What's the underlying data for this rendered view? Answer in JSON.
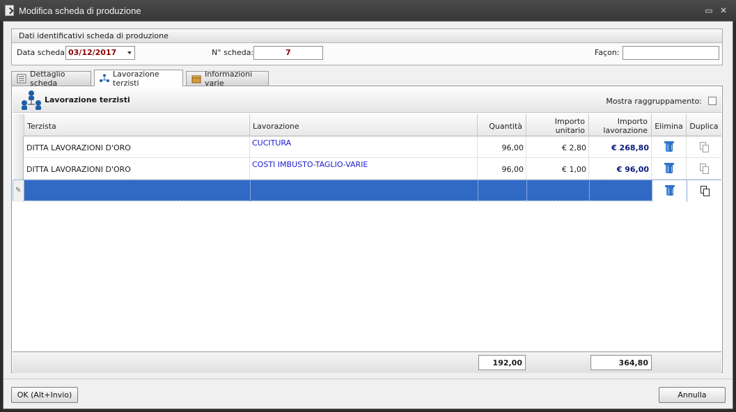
{
  "window": {
    "title": "Modifica scheda di produzione"
  },
  "header_group": {
    "title": "Dati identificativi scheda di produzione",
    "date_label": "Data scheda:",
    "date_value": "03/12/2017",
    "number_label": "N° scheda:",
    "number_value": "7",
    "facon_label": "Façon:",
    "facon_value": ""
  },
  "tabs": [
    {
      "label": "Dettaglio scheda",
      "icon": "list-icon"
    },
    {
      "label": "Lavorazione terzisti",
      "icon": "people-network-icon",
      "active": true
    },
    {
      "label": "Informazioni varie",
      "icon": "box-icon"
    }
  ],
  "panel": {
    "title": "Lavorazione terzisti",
    "show_grouping_label": "Mostra raggruppamento:",
    "show_grouping_checked": false
  },
  "grid": {
    "columns": {
      "terzista": "Terzista",
      "lavorazione": "Lavorazione",
      "quantita": "Quantità",
      "importo_unitario": "Importo unitario",
      "importo_lavorazione": "Importo lavorazione",
      "elimina": "Elimina",
      "duplica": "Duplica"
    },
    "rows": [
      {
        "terzista": "DITTA LAVORAZIONI D'ORO",
        "lavorazione": "CUCITURA",
        "quantita": "96,00",
        "importo_unitario": "€ 2,80",
        "importo_lavorazione": "€ 268,80"
      },
      {
        "terzista": "DITTA LAVORAZIONI D'ORO",
        "lavorazione": "COSTI IMBUSTO-TAGLIO-VARIE",
        "quantita": "96,00",
        "importo_unitario": "€ 1,00",
        "importo_lavorazione": "€ 96,00"
      },
      {
        "terzista": "",
        "lavorazione": "",
        "quantita": "",
        "importo_unitario": "",
        "importo_lavorazione": ""
      }
    ],
    "totals": {
      "quantita": "192,00",
      "importo_lavorazione": "364,80"
    }
  },
  "buttons": {
    "ok": "OK (Alt+Invio)",
    "cancel": "Annulla"
  },
  "colors": {
    "selection": "#316ac5",
    "link": "#1a1acc",
    "bold_amount": "#0a1a7a",
    "date_red": "#8b0000"
  }
}
